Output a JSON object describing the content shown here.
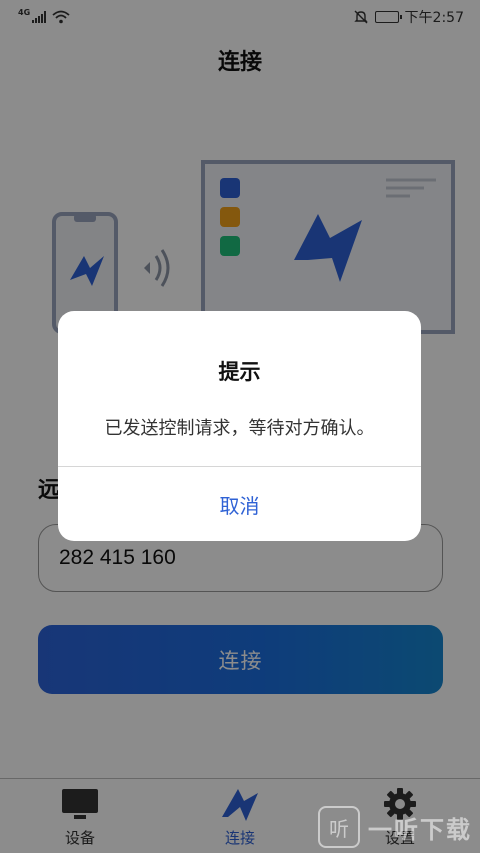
{
  "status_bar": {
    "network_type": "4G",
    "time": "下午2:57",
    "battery_level": 0.35,
    "icons": [
      "signal-icon",
      "wifi-icon",
      "mute-icon",
      "battery-icon"
    ]
  },
  "page": {
    "title": "连接"
  },
  "illustration": {
    "icons": [
      "phone-icon",
      "wireless-icon",
      "monitor-icon",
      "app-logo-icon"
    ],
    "tile_colors": [
      "#2f62d5",
      "#f0a11b",
      "#1fbf7a"
    ],
    "accent": "#2f62d5"
  },
  "form": {
    "remote_label": "远",
    "device_id_value": "282 415 160",
    "connect_label": "连接"
  },
  "dialog": {
    "title": "提示",
    "message": "已发送控制请求，等待对方确认。",
    "cancel_label": "取消"
  },
  "bottom_nav": {
    "items": [
      {
        "label": "设备",
        "icon": "monitor-icon",
        "active": false
      },
      {
        "label": "连接",
        "icon": "app-logo-icon",
        "active": true
      },
      {
        "label": "设置",
        "icon": "gear-icon",
        "active": false
      }
    ],
    "active_color": "#2f62d5"
  },
  "watermark": {
    "badge": "听",
    "text": "一听下载"
  }
}
